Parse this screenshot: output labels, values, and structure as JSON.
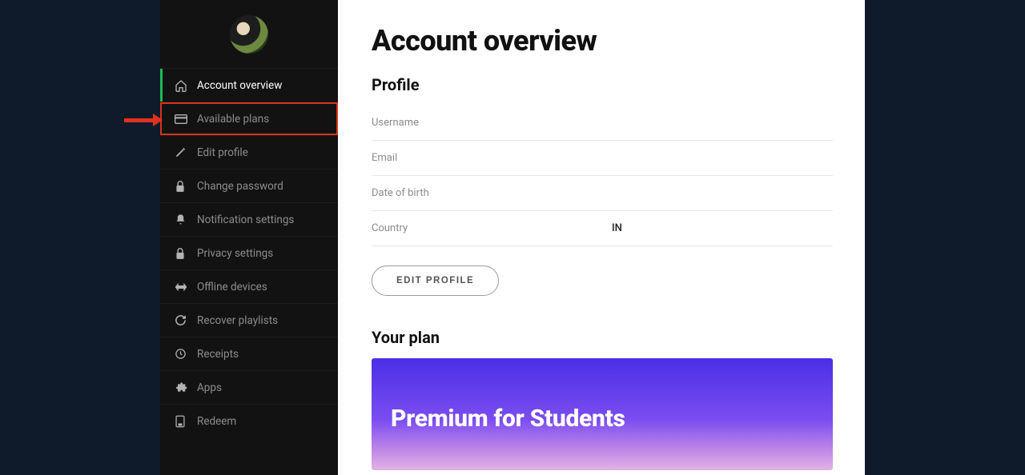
{
  "sidebar": {
    "items": [
      {
        "label": "Account overview",
        "icon": "home"
      },
      {
        "label": "Available plans",
        "icon": "card"
      },
      {
        "label": "Edit profile",
        "icon": "pencil"
      },
      {
        "label": "Change password",
        "icon": "lock"
      },
      {
        "label": "Notification settings",
        "icon": "bell"
      },
      {
        "label": "Privacy settings",
        "icon": "lock"
      },
      {
        "label": "Offline devices",
        "icon": "offline"
      },
      {
        "label": "Recover playlists",
        "icon": "refresh"
      },
      {
        "label": "Receipts",
        "icon": "clock"
      },
      {
        "label": "Apps",
        "icon": "puzzle"
      },
      {
        "label": "Redeem",
        "icon": "redeem"
      }
    ]
  },
  "main": {
    "title": "Account overview",
    "profile": {
      "heading": "Profile",
      "rows": [
        {
          "label": "Username",
          "value": ""
        },
        {
          "label": "Email",
          "value": ""
        },
        {
          "label": "Date of birth",
          "value": ""
        },
        {
          "label": "Country",
          "value": "IN"
        }
      ],
      "edit_btn": "EDIT PROFILE"
    },
    "plan": {
      "heading": "Your plan",
      "card_title": "Premium for Students"
    }
  }
}
